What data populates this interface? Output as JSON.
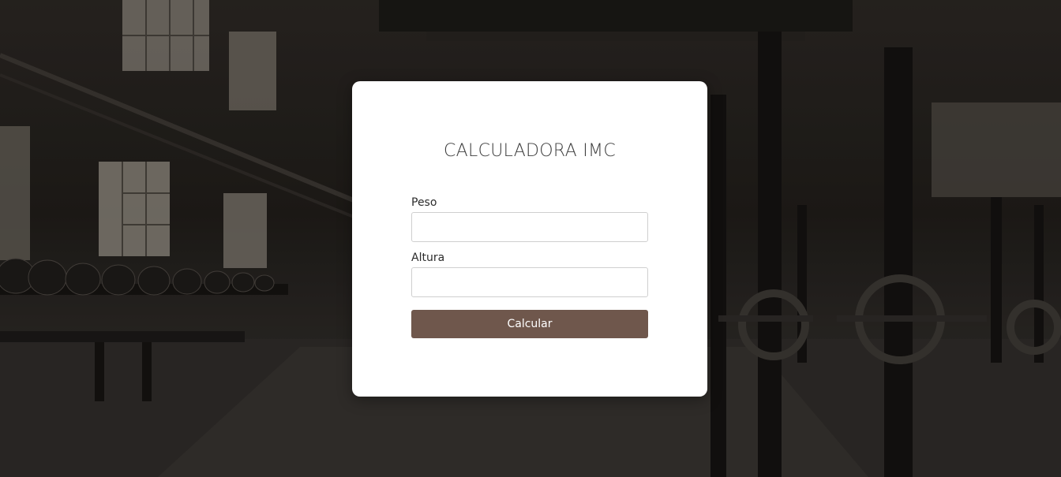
{
  "page": {
    "background": "gym-interior-photo"
  },
  "form": {
    "title": "CALCULADORA IMC",
    "peso": {
      "label": "Peso",
      "value": "",
      "placeholder": ""
    },
    "altura": {
      "label": "Altura",
      "value": "",
      "placeholder": ""
    },
    "button_label": "Calcular"
  },
  "colors": {
    "button": "#6f574c",
    "card": "#ffffff",
    "title_text": "#3d3d3d"
  }
}
